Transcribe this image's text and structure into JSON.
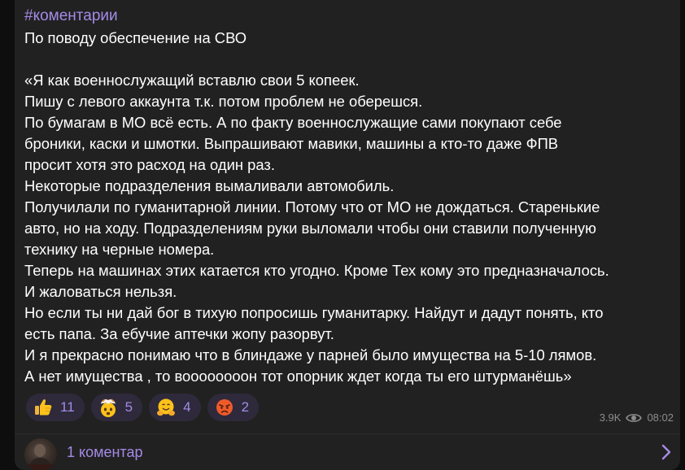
{
  "post": {
    "hashtag": "#коментарии",
    "title": "По поводу обеспечение на СВО",
    "lines": [
      "«Я как военнослужащий вставлю свои 5 копеек.",
      "Пишу с левого аккаунта т.к. потом проблем не оберешся.",
      "По бумагам в МО всё есть. А по факту военнослужащие сами покупают себе",
      "броники, каски и шмотки. Выпрашивают мавики, машины а кто-то даже ФПВ",
      "просит хотя это расход на один раз.",
      "Некоторые подразделения вымаливали автомобиль.",
      "Получилали по гуманитарной линии. Потому что от МО не дождаться. Старенькие",
      "авто, но на ходу. Подразделениям руки выломали чтобы они ставили полученную",
      "технику на черные номера.",
      "Теперь на машинах этих катается кто угодно. Кроме Тех кому это предназначалось.",
      "И жаловаться нельзя.",
      "Но если ты ни дай бог в тихую попросишь гуманитарку. Найдут и дадут понять, кто",
      "есть папа. За ебучие аптечки жопу разорвут.",
      "И я прекрасно понимаю что в блиндаже у парней было имущества на 5-10 лямов.",
      "А нет имущества , то воооооооон тот опорник ждет когда ты его штурманёшь»"
    ]
  },
  "reactions": [
    {
      "icon": "thumbs-up-icon",
      "count": "11"
    },
    {
      "icon": "exploding-head-icon",
      "count": "5"
    },
    {
      "icon": "hugging-face-icon",
      "count": "4"
    },
    {
      "icon": "angry-face-icon",
      "count": "2"
    }
  ],
  "meta": {
    "views": "3.9K",
    "time": "08:02"
  },
  "comments": {
    "label": "1 коментар"
  },
  "colors": {
    "accent": "#a58ae6",
    "bubble": "#212121",
    "text": "#ffffff",
    "reaction_bg": "#2e2a3b"
  }
}
